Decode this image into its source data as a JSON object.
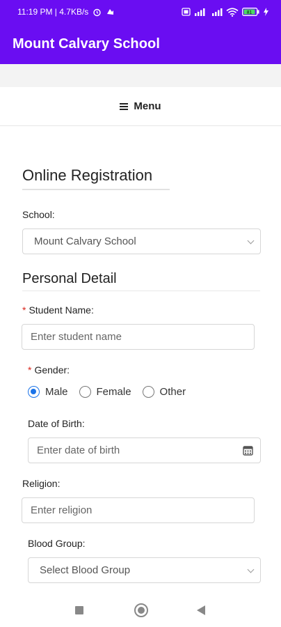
{
  "status_bar": {
    "left_text": "11:19 PM | 4.7KB/s",
    "battery": "81"
  },
  "app_bar": {
    "title": "Mount Calvary School"
  },
  "menu": {
    "label": "Menu"
  },
  "form": {
    "heading": "Online Registration",
    "school": {
      "label": "School:",
      "selected": "Mount Calvary School"
    },
    "personal_heading": "Personal Detail",
    "student_name": {
      "required_mark": "*",
      "label": "Student Name:",
      "placeholder": "Enter student name"
    },
    "gender": {
      "required_mark": "*",
      "label": "Gender:",
      "options": [
        "Male",
        "Female",
        "Other"
      ],
      "selected": "Male"
    },
    "dob": {
      "label": "Date of Birth:",
      "placeholder": "Enter date of birth"
    },
    "religion": {
      "label": "Religion:",
      "placeholder": "Enter religion"
    },
    "blood_group": {
      "label": "Blood Group:",
      "selected": "Select Blood Group"
    }
  },
  "colors": {
    "brand": "#6a0df2",
    "radio_selected": "#1a73e8",
    "required": "#d9261c"
  }
}
